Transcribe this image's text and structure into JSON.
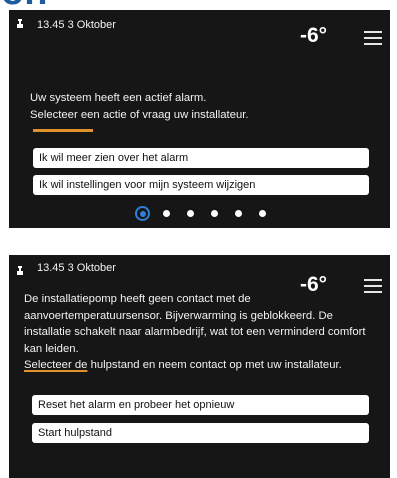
{
  "screen1": {
    "datetime": "13.45 3  Oktober",
    "temperature": "-6°",
    "message_lines": [
      "Uw systeem heeft een actief alarm.",
      "Selecteer een actie of vraag uw installateur."
    ],
    "options": [
      "Ik wil meer zien over het alarm",
      "Ik wil instellingen voor mijn systeem wijzigen"
    ],
    "page_dots": {
      "count": 6,
      "active_index": 1
    }
  },
  "screen2": {
    "datetime": "13.45 3 Oktober",
    "temperature": "-6°",
    "message": "De installatiepomp heeft geen contact met de aanvoertemperatuursensor. Bijverwarming is geblokkeerd. De installatie schakelt naar alarmbedrijf, wat tot een verminderd comfort kan leiden.",
    "action_highlight": "Selecteer de",
    "action_rest": " hulpstand en neem contact op met uw installateur.",
    "options": [
      "Reset het alarm en probeer het opnieuw",
      "Start hulpstand"
    ]
  },
  "colors": {
    "screen_bg": "#161616",
    "accent": "#e0932c",
    "active_dot": "#2f7fd8",
    "fragment_text": "#1f5c9e"
  },
  "icons": [
    "usb-icon",
    "menu-icon",
    "pager-dot-active-icon"
  ]
}
